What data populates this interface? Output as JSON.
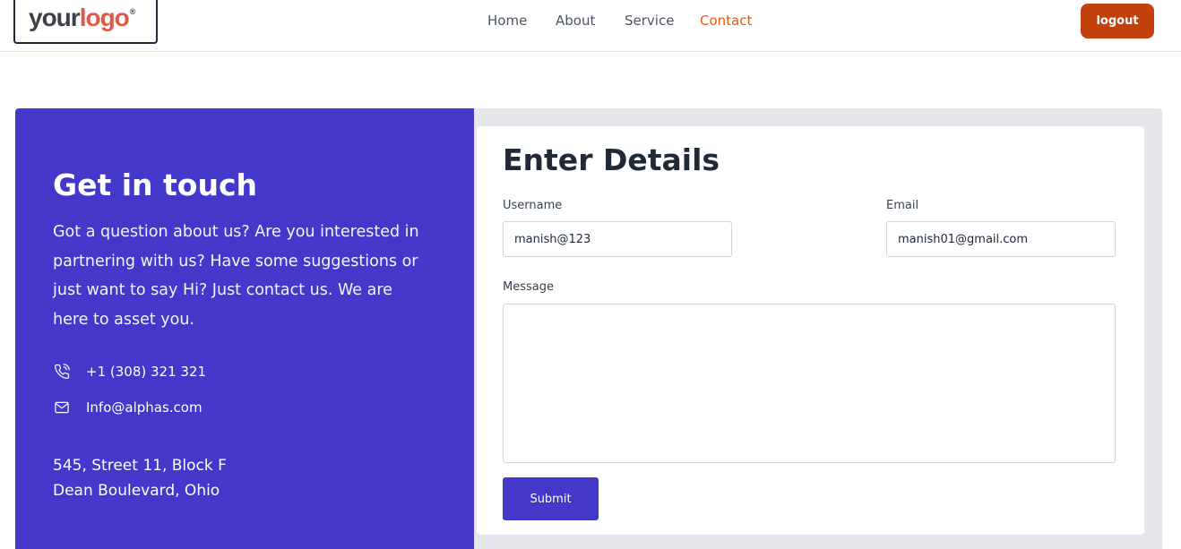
{
  "header": {
    "logo": {
      "your": "your",
      "logo": "logo",
      "reg": "®"
    },
    "nav": [
      {
        "label": "Home"
      },
      {
        "label": "About"
      },
      {
        "label": "Service"
      },
      {
        "label": "Contact",
        "active": true
      }
    ],
    "logout_label": "logout"
  },
  "contact_info": {
    "title": "Get in touch",
    "description": "Got a question about us? Are you interested in partnering with us? Have some suggestions or just want to say Hi? Just contact us. We are here to asset you.",
    "phone": "+1 (308) 321 321",
    "email": "Info@alphas.com",
    "address_line1": "545, Street 11, Block F",
    "address_line2": "Dean Boulevard, Ohio"
  },
  "form": {
    "title": "Enter Details",
    "username_label": "Username",
    "username_value": "manish@123",
    "email_label": "Email",
    "email_value": "manish01@gmail.com",
    "message_label": "Message",
    "message_value": "",
    "submit_label": "Submit"
  },
  "colors": {
    "accent": "#4338ca",
    "nav_active": "#ea580c",
    "logout": "#c2410c"
  },
  "icons": {
    "phone": "phone-icon",
    "mail": "mail-icon"
  }
}
